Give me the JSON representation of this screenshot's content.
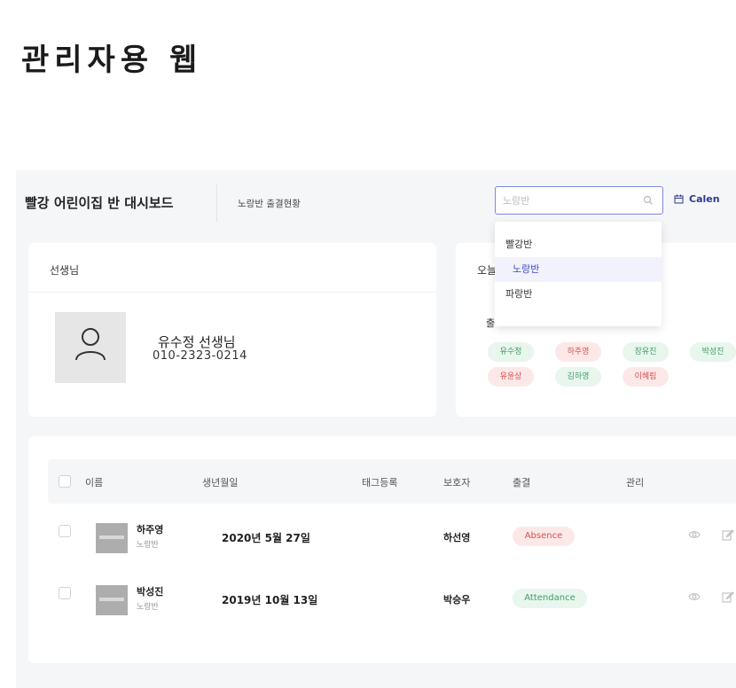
{
  "page": {
    "title": "관리자용 웹"
  },
  "header": {
    "brand": "빨강 어린이집 반 대시보드",
    "subtitle": "노랑반 출결현황",
    "search": {
      "value": "노랑반"
    },
    "calendar_label": "Calen",
    "dropdown": [
      "빨강반",
      "노랑반",
      "파랑반"
    ]
  },
  "teacher_card": {
    "heading": "선생님",
    "name": "유수정 선생님",
    "phone": "010-2323-0214"
  },
  "today_card": {
    "heading": "오늘",
    "attendance_label": "출",
    "chips": [
      {
        "name": "유수정",
        "status": "green"
      },
      {
        "name": "하주영",
        "status": "red"
      },
      {
        "name": "장유진",
        "status": "green"
      },
      {
        "name": "박성진",
        "status": "green"
      },
      {
        "name": "유윤상",
        "status": "red"
      },
      {
        "name": "김하영",
        "status": "green"
      },
      {
        "name": "이혜림",
        "status": "red"
      }
    ]
  },
  "table": {
    "columns": [
      "이름",
      "생년월일",
      "태그등록",
      "보호자",
      "출결",
      "관리"
    ],
    "rows": [
      {
        "name": "하주영",
        "class": "노랑반",
        "birth": "2020년 5월 27일",
        "guardian": "하선영",
        "status": "Absence"
      },
      {
        "name": "박성진",
        "class": "노랑반",
        "birth": "2019년 10월 13일",
        "guardian": "박승우",
        "status": "Attendance"
      }
    ]
  },
  "colors": {
    "accent": "#3f4bc4",
    "absence_bg": "#fde8e8",
    "attendance_bg": "#e8f6ee"
  }
}
